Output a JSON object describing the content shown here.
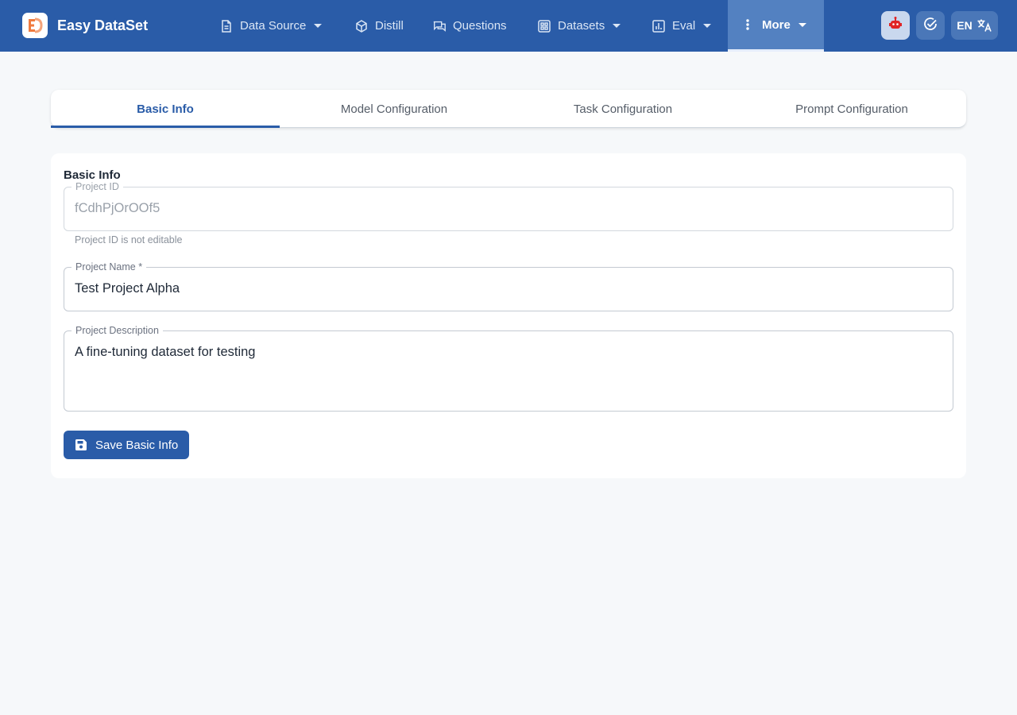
{
  "app": {
    "name": "Easy DataSet"
  },
  "nav": {
    "items": [
      {
        "label": "Data Source",
        "icon": "document-icon",
        "dropdown": true
      },
      {
        "label": "Distill",
        "icon": "cube-icon",
        "dropdown": false
      },
      {
        "label": "Questions",
        "icon": "chat-icon",
        "dropdown": false
      },
      {
        "label": "Datasets",
        "icon": "grid-icon",
        "dropdown": true
      },
      {
        "label": "Eval",
        "icon": "bar-chart-icon",
        "dropdown": true
      },
      {
        "label": "More",
        "icon": "more-vertical-icon",
        "dropdown": true,
        "active": true
      }
    ],
    "lang_label": "EN"
  },
  "tabs": [
    {
      "label": "Basic Info",
      "active": true
    },
    {
      "label": "Model Configuration"
    },
    {
      "label": "Task Configuration"
    },
    {
      "label": "Prompt Configuration"
    }
  ],
  "form": {
    "section_title": "Basic Info",
    "project_id": {
      "label": "Project ID",
      "value": "fCdhPjOrOOf5",
      "helper": "Project ID is not editable",
      "disabled": true
    },
    "project_name": {
      "label": "Project Name *",
      "value": "Test Project Alpha"
    },
    "project_description": {
      "label": "Project Description",
      "value": "A fine-tuning dataset for testing"
    },
    "save_label": "Save Basic Info"
  },
  "colors": {
    "primary": "#2a5ca8",
    "background": "#f6f8fa",
    "accent_orange": "#f07b3f",
    "robot_red": "#e02424"
  }
}
